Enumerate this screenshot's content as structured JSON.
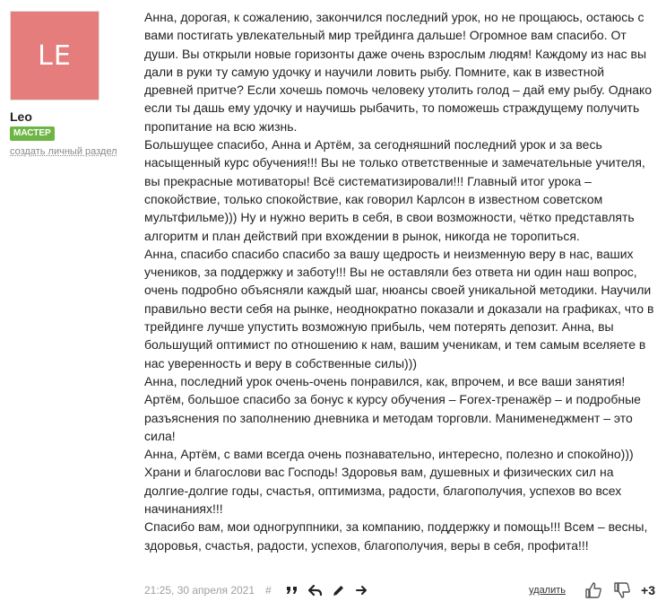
{
  "author": {
    "initials": "LE",
    "name": "Leo",
    "badge": "МАСТЕР",
    "create_link": "создать личный раздел",
    "avatar_color": "#e57d7d",
    "badge_color": "#6db544"
  },
  "message": {
    "paragraphs": [
      "Анна, дорогая, к сожалению, закончился последний урок, но не прощаюсь, остаюсь с вами постигать увлекательный мир трейдинга дальше! Огромное вам спасибо. От души. Вы открыли новые горизонты даже очень взрослым людям! Каждому из нас вы дали в руки ту самую удочку и научили ловить рыбу. Помните, как в известной древней притче? Если хочешь помочь человеку утолить голод – дай ему рыбу. Однако если ты дашь ему удочку и научишь рыбачить, то поможешь страждущему получить пропитание на всю жизнь.",
      "Большущее спасибо, Анна и Артём, за сегодняшний последний урок и за весь насыщенный курс обучения!!! Вы не только ответственные и замечательные учителя, вы прекрасные мотиваторы! Всё систематизировали!!! Главный итог урока – спокойствие, только спокойствие, как говорил Карлсон в известном советском мультфильме))) Ну и нужно верить в себя, в свои возможности, чётко представлять алгоритм и план действий при вхождении в рынок, никогда не торопиться.",
      "Анна, спасибо спасибо спасибо за вашу щедрость и неизменную веру в нас, ваших учеников, за поддержку и заботу!!! Вы не оставляли без ответа ни один наш вопрос, очень подробно объясняли каждый шаг, нюансы своей уникальной методики. Научили правильно вести себя на рынке, неоднократно показали и доказали на графиках, что в трейдинге лучше упустить возможную прибыль, чем потерять депозит. Анна, вы большущий оптимист по отношению к нам, вашим ученикам, и тем самым вселяете в нас уверенность и веру в собственные силы)))",
      "Анна, последний урок очень-очень понравился, как, впрочем, и все ваши занятия! Артём, большое спасибо за бонус к курсу обучения – Forex-тренажёр – и подробные разъяснения по заполнению дневника и методам торговли. Манименеджмент – это сила!",
      "Анна, Артём, с вами всегда очень познавательно, интересно, полезно и спокойно))) Храни и благослови вас Господь! Здоровья вам, душевных и физических сил на долгие-долгие годы, счастья, оптимизма, радости, благополучия, успехов во всех начинаниях!!!",
      "Спасибо вам, мои одногруппники, за компанию, поддержку и помощь!!! Всем – весны, здоровья, счастья, радости, успехов, благополучия, веры в себя, профита!!!"
    ]
  },
  "footer": {
    "timestamp": "21:25, 30 апреля 2021",
    "hash": "#",
    "delete_label": "удалить",
    "score": "+3",
    "icons": [
      "quote-icon",
      "reply-icon",
      "edit-icon",
      "forward-icon",
      "thumbs-up-icon",
      "thumbs-down-icon"
    ]
  }
}
